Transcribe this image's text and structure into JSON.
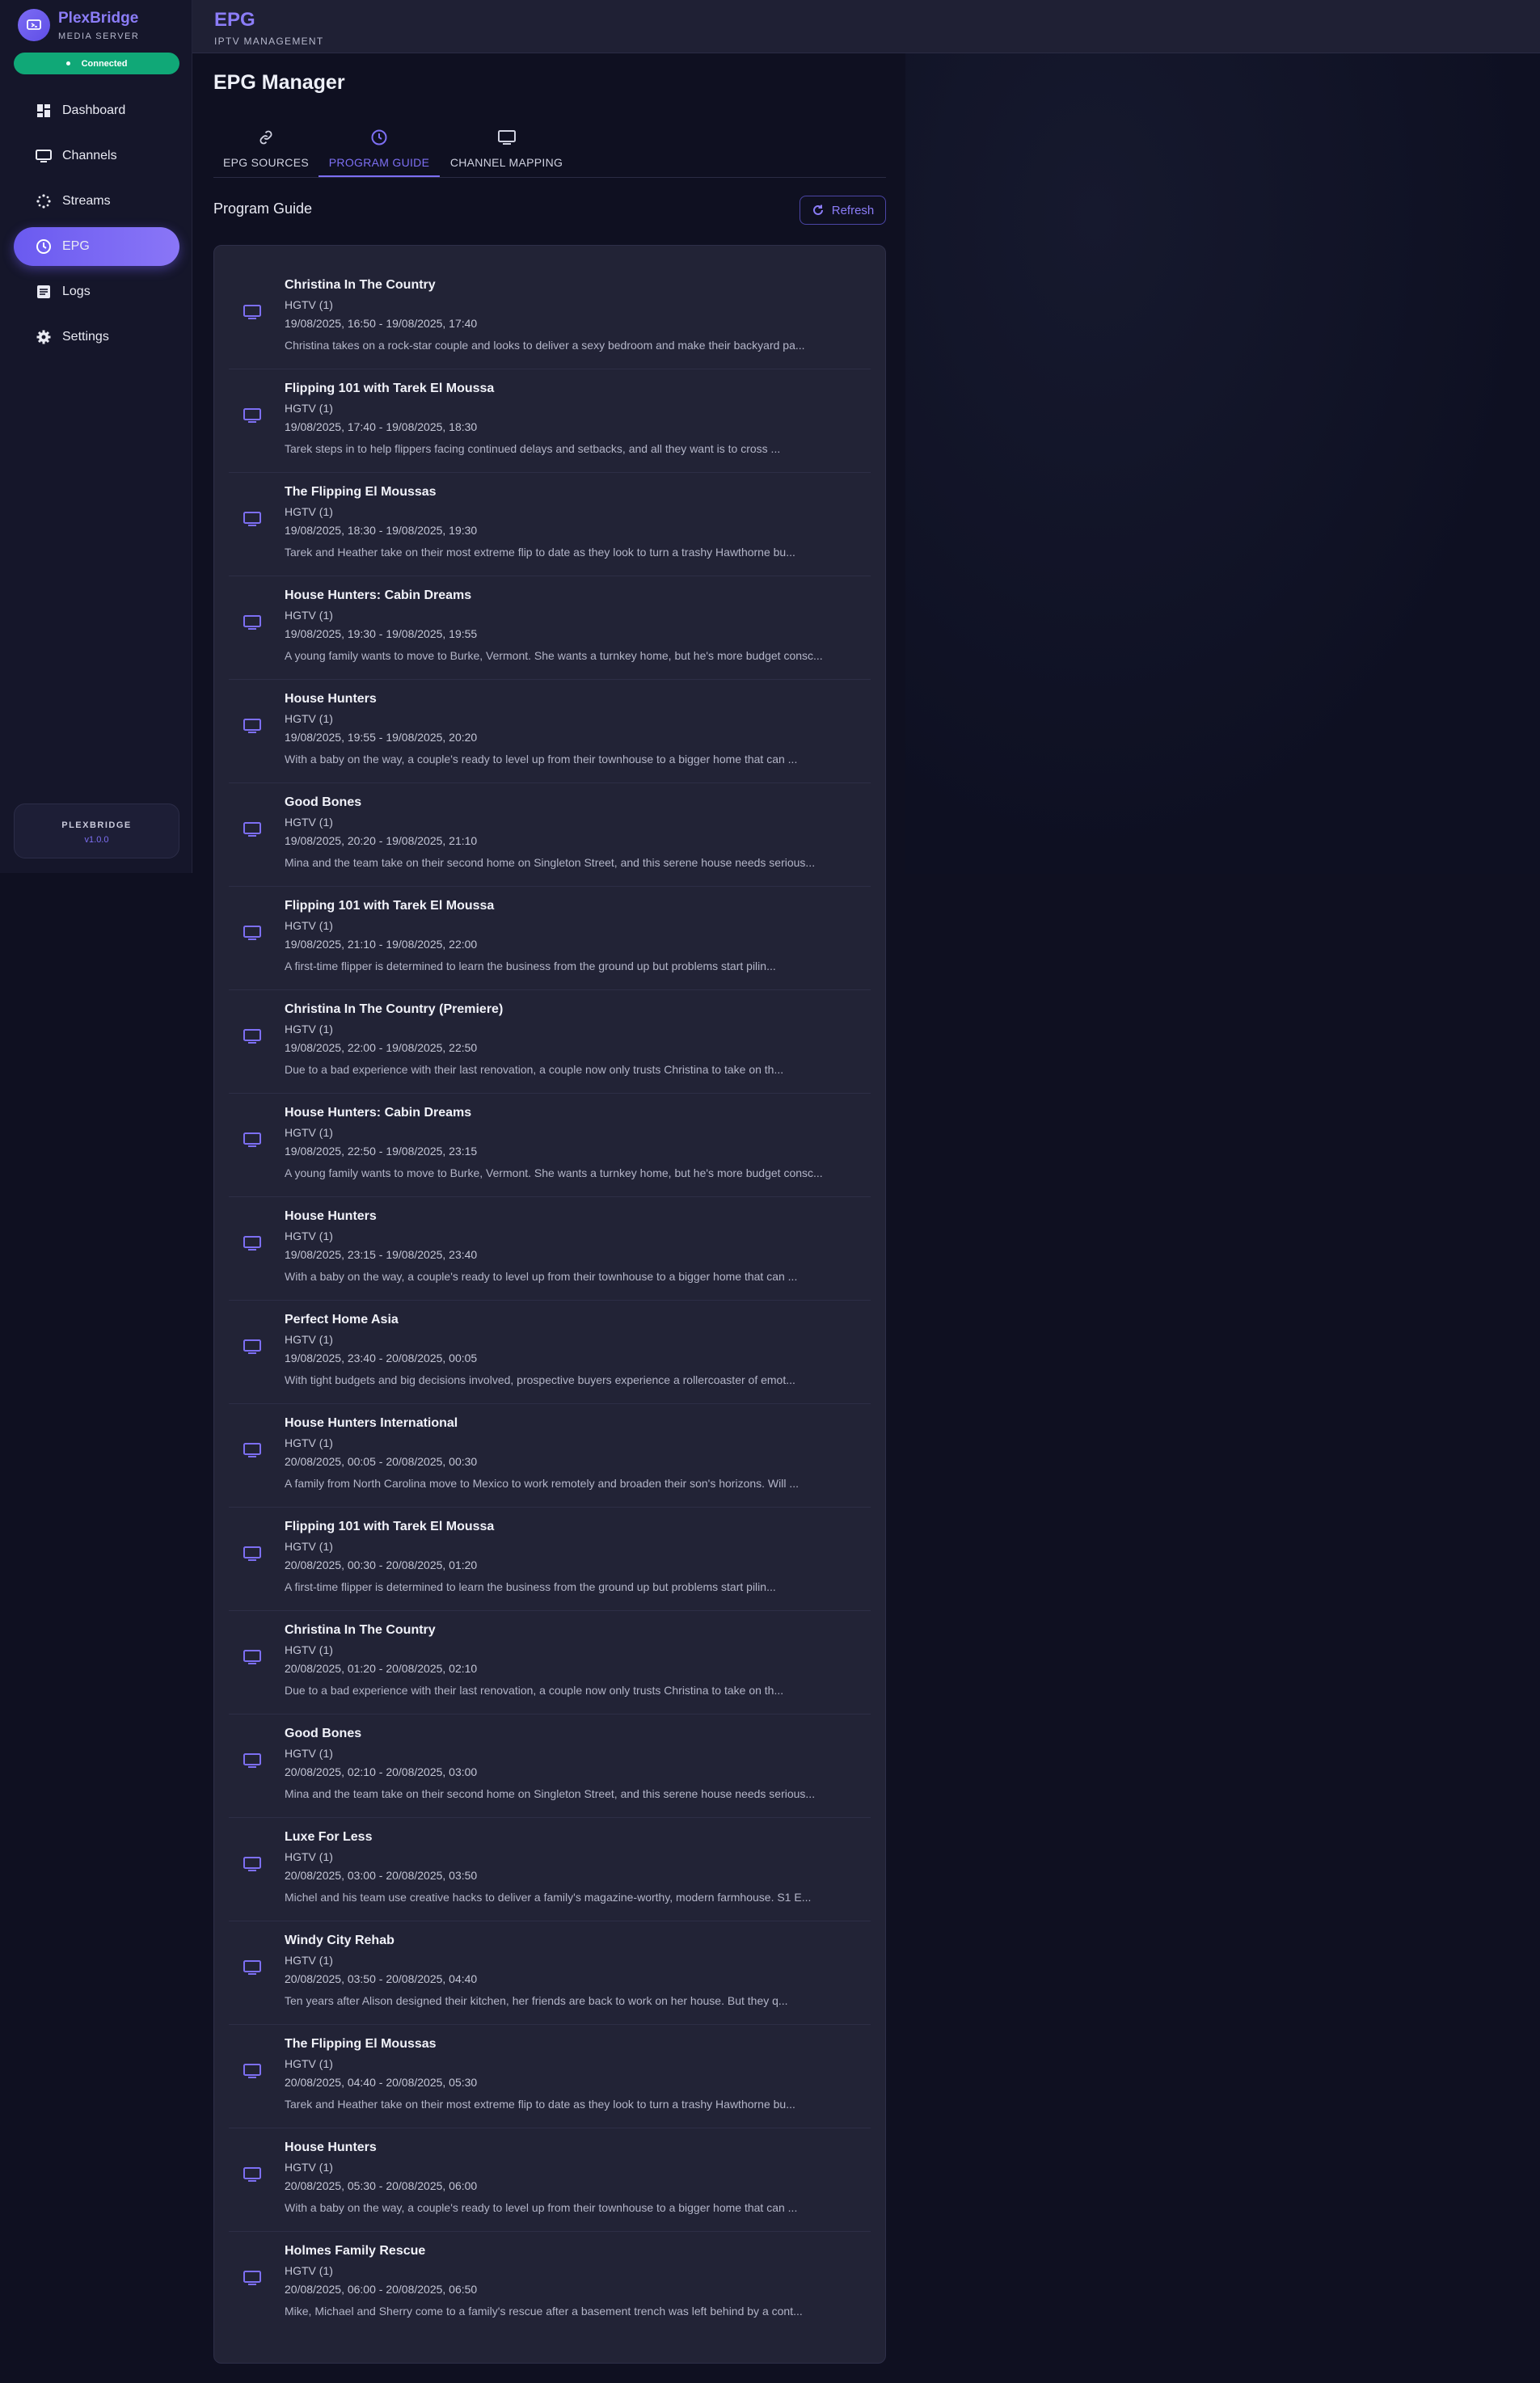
{
  "brand": {
    "name": "PlexBridge",
    "subtitle": "MEDIA SERVER",
    "status": "Connected"
  },
  "nav": [
    {
      "label": "Dashboard",
      "icon": "dashboard-icon"
    },
    {
      "label": "Channels",
      "icon": "tv-icon"
    },
    {
      "label": "Streams",
      "icon": "streams-icon"
    },
    {
      "label": "EPG",
      "icon": "clock-icon",
      "active": true
    },
    {
      "label": "Logs",
      "icon": "logs-icon"
    },
    {
      "label": "Settings",
      "icon": "gear-icon"
    }
  ],
  "version": {
    "name": "PLEXBRIDGE",
    "number": "v1.0.0"
  },
  "header": {
    "title": "EPG",
    "subtitle": "IPTV MANAGEMENT"
  },
  "page": {
    "title": "EPG Manager"
  },
  "tabs": [
    {
      "label": "EPG SOURCES",
      "icon": "link-icon"
    },
    {
      "label": "PROGRAM GUIDE",
      "icon": "clock-icon",
      "active": true
    },
    {
      "label": "CHANNEL MAPPING",
      "icon": "tv-icon"
    }
  ],
  "section": {
    "title": "Program Guide",
    "refresh_label": "Refresh"
  },
  "colors": {
    "accent": "#7d6ff3",
    "connected": "#10a877",
    "background": "#0f1021",
    "card": "#222336"
  },
  "programs": [
    {
      "title": "Christina In The Country",
      "channel": "HGTV (1)",
      "time": "19/08/2025, 16:50 - 19/08/2025, 17:40",
      "desc": "Christina takes on a rock-star couple and looks to deliver a sexy bedroom and make their backyard pa..."
    },
    {
      "title": "Flipping 101 with Tarek El Moussa",
      "channel": "HGTV (1)",
      "time": "19/08/2025, 17:40 - 19/08/2025, 18:30",
      "desc": "Tarek steps in to help flippers facing continued delays and setbacks, and all they want is to cross ..."
    },
    {
      "title": "The Flipping El Moussas",
      "channel": "HGTV (1)",
      "time": "19/08/2025, 18:30 - 19/08/2025, 19:30",
      "desc": "Tarek and Heather take on their most extreme flip to date as they look to turn a trashy Hawthorne bu..."
    },
    {
      "title": "House Hunters: Cabin Dreams",
      "channel": "HGTV (1)",
      "time": "19/08/2025, 19:30 - 19/08/2025, 19:55",
      "desc": "A young family wants to move to Burke, Vermont. She wants a turnkey home, but he's more budget consc..."
    },
    {
      "title": "House Hunters",
      "channel": "HGTV (1)",
      "time": "19/08/2025, 19:55 - 19/08/2025, 20:20",
      "desc": "With a baby on the way, a couple's ready to level up from their townhouse to a bigger home that can ..."
    },
    {
      "title": "Good Bones",
      "channel": "HGTV (1)",
      "time": "19/08/2025, 20:20 - 19/08/2025, 21:10",
      "desc": "Mina and the team take on their second home on Singleton Street, and this serene house needs serious..."
    },
    {
      "title": "Flipping 101 with Tarek El Moussa",
      "channel": "HGTV (1)",
      "time": "19/08/2025, 21:10 - 19/08/2025, 22:00",
      "desc": "A first-time flipper is determined to learn the business from the ground up but problems start pilin..."
    },
    {
      "title": "Christina In The Country (Premiere)",
      "channel": "HGTV (1)",
      "time": "19/08/2025, 22:00 - 19/08/2025, 22:50",
      "desc": "Due to a bad experience with their last renovation, a couple now only trusts Christina to take on th..."
    },
    {
      "title": "House Hunters: Cabin Dreams",
      "channel": "HGTV (1)",
      "time": "19/08/2025, 22:50 - 19/08/2025, 23:15",
      "desc": "A young family wants to move to Burke, Vermont. She wants a turnkey home, but he's more budget consc..."
    },
    {
      "title": "House Hunters",
      "channel": "HGTV (1)",
      "time": "19/08/2025, 23:15 - 19/08/2025, 23:40",
      "desc": "With a baby on the way, a couple's ready to level up from their townhouse to a bigger home that can ..."
    },
    {
      "title": "Perfect Home Asia",
      "channel": "HGTV (1)",
      "time": "19/08/2025, 23:40 - 20/08/2025, 00:05",
      "desc": "With tight budgets and big decisions involved, prospective buyers experience a rollercoaster of emot..."
    },
    {
      "title": "House Hunters International",
      "channel": "HGTV (1)",
      "time": "20/08/2025, 00:05 - 20/08/2025, 00:30",
      "desc": "A family from North Carolina move to Mexico to work remotely and broaden their son's horizons. Will ..."
    },
    {
      "title": "Flipping 101 with Tarek El Moussa",
      "channel": "HGTV (1)",
      "time": "20/08/2025, 00:30 - 20/08/2025, 01:20",
      "desc": "A first-time flipper is determined to learn the business from the ground up but problems start pilin..."
    },
    {
      "title": "Christina In The Country",
      "channel": "HGTV (1)",
      "time": "20/08/2025, 01:20 - 20/08/2025, 02:10",
      "desc": "Due to a bad experience with their last renovation, a couple now only trusts Christina to take on th..."
    },
    {
      "title": "Good Bones",
      "channel": "HGTV (1)",
      "time": "20/08/2025, 02:10 - 20/08/2025, 03:00",
      "desc": "Mina and the team take on their second home on Singleton Street, and this serene house needs serious..."
    },
    {
      "title": "Luxe For Less",
      "channel": "HGTV (1)",
      "time": "20/08/2025, 03:00 - 20/08/2025, 03:50",
      "desc": "Michel and his team use creative hacks to deliver a family's magazine-worthy, modern farmhouse. S1 E..."
    },
    {
      "title": "Windy City Rehab",
      "channel": "HGTV (1)",
      "time": "20/08/2025, 03:50 - 20/08/2025, 04:40",
      "desc": "Ten years after Alison designed their kitchen, her friends are back to work on her house. But they q..."
    },
    {
      "title": "The Flipping El Moussas",
      "channel": "HGTV (1)",
      "time": "20/08/2025, 04:40 - 20/08/2025, 05:30",
      "desc": "Tarek and Heather take on their most extreme flip to date as they look to turn a trashy Hawthorne bu..."
    },
    {
      "title": "House Hunters",
      "channel": "HGTV (1)",
      "time": "20/08/2025, 05:30 - 20/08/2025, 06:00",
      "desc": "With a baby on the way, a couple's ready to level up from their townhouse to a bigger home that can ..."
    },
    {
      "title": "Holmes Family Rescue",
      "channel": "HGTV (1)",
      "time": "20/08/2025, 06:00 - 20/08/2025, 06:50",
      "desc": "Mike, Michael and Sherry come to a family's rescue after a basement trench was left behind by a cont..."
    }
  ]
}
